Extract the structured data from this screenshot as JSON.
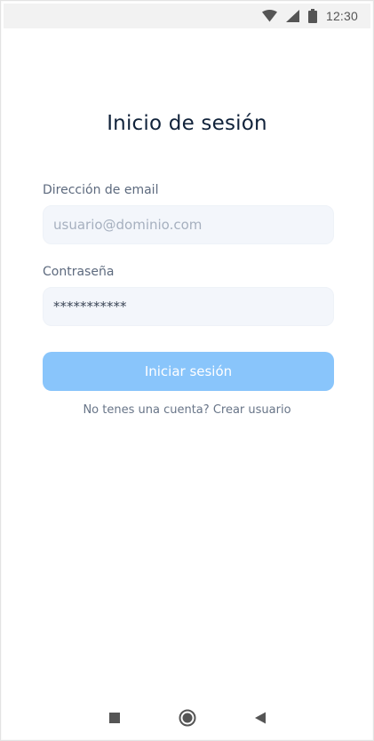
{
  "status_bar": {
    "time": "12:30",
    "icons": [
      "wifi-icon",
      "cellular-signal-icon",
      "battery-icon"
    ]
  },
  "login": {
    "title": "Inicio de sesión",
    "email_label": "Dirección de email",
    "email_placeholder": "usuario@dominio.com",
    "email_value": "",
    "password_label": "Contraseña",
    "password_value": "***********",
    "submit_label": "Iniciar sesión",
    "signup_prompt": "No tenes una cuenta?",
    "signup_link": "Crear usuario"
  },
  "nav_bar": {
    "buttons": [
      "recents-square-icon",
      "home-circle-icon",
      "back-triangle-icon"
    ]
  },
  "colors": {
    "title": "#10223a",
    "label": "#5d6a7e",
    "input_bg": "#f3f6fb",
    "button_bg": "#89c5fb",
    "button_text": "#ffffff",
    "status_bar_bg": "#f2f2f2"
  }
}
